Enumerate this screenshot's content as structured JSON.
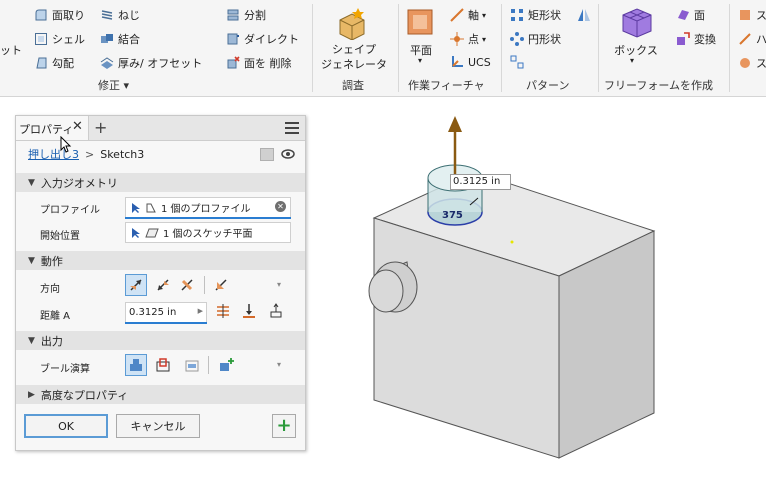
{
  "ribbon": {
    "modify": {
      "fillet": "面取り",
      "thread": "ねじ",
      "split": "分割",
      "shell": "シェル",
      "combine": "結合",
      "direct": "ダイレクト",
      "draft": "勾配",
      "thicken": "厚み/ オフセット",
      "delete_face": "面を 削除",
      "cut_left": "ット",
      "group_label": "修正 ▾"
    },
    "explore": {
      "shape_generator": "シェイプ\nジェネレータ",
      "group_label": "調査"
    },
    "work_features": {
      "plane": "平面",
      "axis": "軸",
      "point": "点",
      "ucs": "UCS",
      "group_label": "作業フィーチャ"
    },
    "pattern": {
      "rectangular": "矩形状",
      "circular": "円形状",
      "group_label": "パターン"
    },
    "freeform": {
      "box": "ボックス",
      "face": "面",
      "convert": "変換",
      "group_label": "フリーフォームを作成"
    },
    "right_cut": {
      "a": "ス",
      "b": "ハ",
      "c": "ス"
    }
  },
  "panel": {
    "tab_label": "プロパティ",
    "breadcrumb_link": "押し出し3",
    "breadcrumb_sep": ">",
    "breadcrumb_current": "Sketch3",
    "input_geometry": {
      "title": "入力ジオメトリ",
      "profile_label": "プロファイル",
      "profile_value": "1 個のプロファイル",
      "start_label": "開始位置",
      "start_value": "1 個のスケッチ平面"
    },
    "behavior": {
      "title": "動作",
      "direction_label": "方向",
      "distance_label": "距離 A",
      "distance_value": "0.3125 in"
    },
    "output": {
      "title": "出力",
      "boolean_label": "ブール演算"
    },
    "advanced": {
      "title": "高度なプロパティ"
    },
    "ok_label": "OK",
    "cancel_label": "キャンセル"
  },
  "viewport": {
    "distance_tag": "0.3125 in",
    "dim_text": "375"
  }
}
